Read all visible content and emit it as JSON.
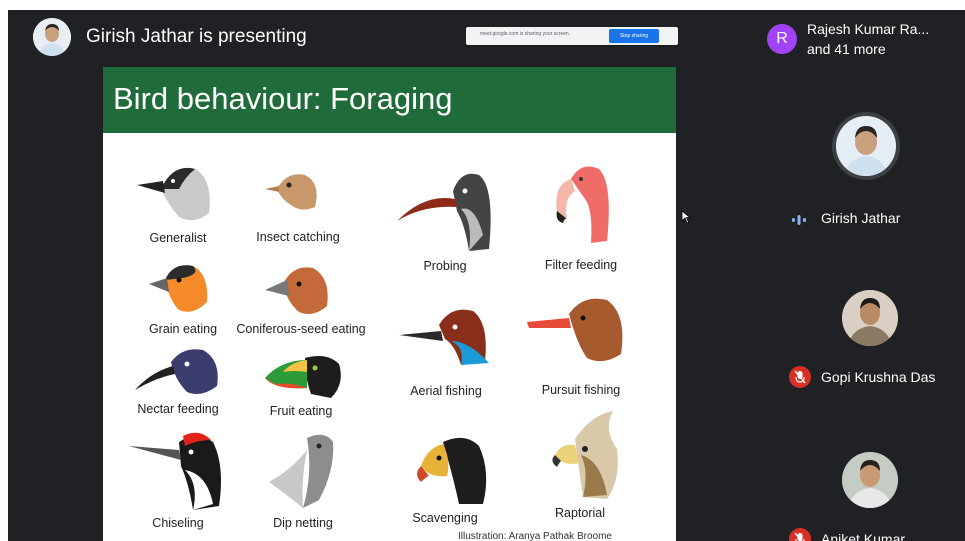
{
  "topbar": {
    "presenter_text": "Girish Jathar is presenting",
    "others": {
      "initial": "R",
      "name": "Rajesh Kumar Ra...",
      "more": "and 41 more"
    }
  },
  "share_banner": {
    "text": "meet.google.com is sharing your screen.",
    "stop_label": "Stop sharing"
  },
  "slide": {
    "title": "Bird behaviour: Foraging",
    "birds": [
      {
        "label": "Generalist"
      },
      {
        "label": "Insect catching"
      },
      {
        "label": "Probing"
      },
      {
        "label": "Filter feeding"
      },
      {
        "label": "Grain eating"
      },
      {
        "label": "Coniferous-seed eating"
      },
      {
        "label": "Aerial fishing"
      },
      {
        "label": "Pursuit fishing"
      },
      {
        "label": "Nectar feeding"
      },
      {
        "label": "Fruit eating"
      },
      {
        "label": "Chiseling"
      },
      {
        "label": "Dip netting"
      },
      {
        "label": "Scavenging"
      },
      {
        "label": "Raptorial"
      }
    ],
    "caption": "Illustration: Aranya Pathak Broome"
  },
  "participants": [
    {
      "name": "Girish Jathar",
      "status": "speaking"
    },
    {
      "name": "Gopi Krushna Das",
      "status": "muted"
    },
    {
      "name": "Aniket Kumar",
      "status": "muted"
    }
  ],
  "colors": {
    "background": "#202124",
    "slide_header": "#1f6b3a",
    "muted": "#d93025",
    "speaking": "#1e8e3e",
    "chip_avatar": "#a142f4"
  }
}
